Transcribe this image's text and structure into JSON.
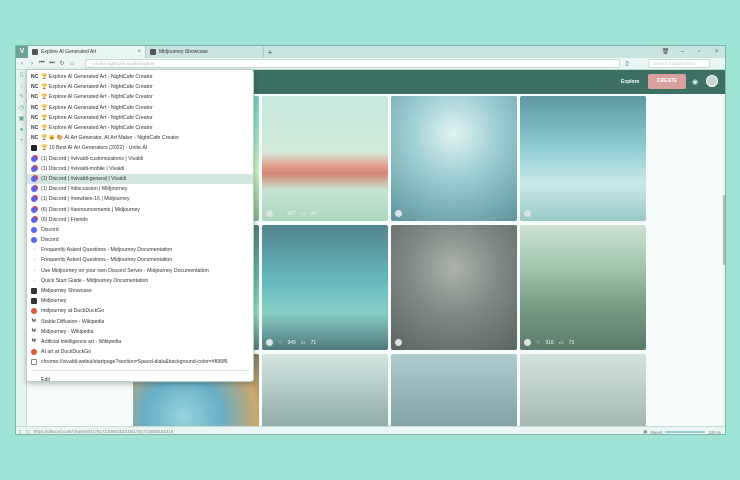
{
  "browser": {
    "tabs": [
      {
        "label": "Explore AI Generated Art",
        "active": true
      },
      {
        "label": "Midjourney Showcase",
        "active": false
      }
    ],
    "url": "creator.nightcafe.studio/explore",
    "search_placeholder": "Search DuckDuckGo",
    "status_url": "https://discord.com/channels/1751713080152316/1751713080152316",
    "zoom": "100 %",
    "reset_label": "Reset"
  },
  "site": {
    "explore_label": "Explore",
    "create_label": "CREATE",
    "accent": "#d9a0a0",
    "header_color": "#3e6f63"
  },
  "cards": [
    {
      "likes": "970",
      "comments": "43"
    },
    {
      "likes": "967",
      "comments": "24"
    },
    {
      "likes": "949",
      "comments": "71"
    },
    {
      "likes": "916",
      "comments": "73"
    }
  ],
  "menu": {
    "items": [
      {
        "icon": "nightcafe-icon",
        "label": "🏆 Explore AI Generated Art - NightCafe Creator"
      },
      {
        "icon": "nightcafe-icon",
        "label": "🏆 Explore AI Generated Art - NightCafe Creator"
      },
      {
        "icon": "nightcafe-icon",
        "label": "🏆 Explore AI Generated Art - NightCafe Creator"
      },
      {
        "icon": "nightcafe-icon",
        "label": "🏆 Explore AI Generated Art - NightCafe Creator"
      },
      {
        "icon": "nightcafe-icon",
        "label": "🏆 Explore AI Generated Art - NightCafe Creator"
      },
      {
        "icon": "nightcafe-icon",
        "label": "🏆 Explore AI Generated Art - NightCafe Creator"
      },
      {
        "icon": "nightcafe-icon",
        "label": "🏆 😺 🎨 AI Art Generator, AI Art Maker - NightCafe Creator"
      },
      {
        "icon": "unite-icon",
        "label": "🏆 10 Best AI Art Generators (2022) - Unite.AI"
      },
      {
        "icon": "discord-icon",
        "label": "(1) Discord | #vivaldi-customizations | Vivaldi"
      },
      {
        "icon": "discord-icon",
        "label": "(1) Discord | #vivaldi-mobile | Vivaldi"
      },
      {
        "icon": "discord-icon",
        "label": "(1) Discord | #vivaldi-general | Vivaldi",
        "selected": true
      },
      {
        "icon": "discord-icon",
        "label": "(1) Discord | #discussion | Midjourney"
      },
      {
        "icon": "discord-icon",
        "label": "(1) Discord | #newbies-16 | Midjourney"
      },
      {
        "icon": "discord-icon",
        "label": "(6) Discord | #announcements | Midjourney"
      },
      {
        "icon": "discord-icon",
        "label": "(6) Discord | Friends"
      },
      {
        "icon": "discord-icon",
        "label": "Discord"
      },
      {
        "icon": "discord-icon",
        "label": "Discord"
      },
      {
        "icon": "rss-icon",
        "label": "Frequently Asked Questions - Midjourney Documentation"
      },
      {
        "icon": "rss-icon",
        "label": "Frequently Asked Questions - Midjourney Documentation"
      },
      {
        "icon": "rss-icon",
        "label": "Use Midjourney on your own Discord Server - Midjourney Documentation"
      },
      {
        "icon": "rss-icon",
        "label": "Quick Start Guide - Midjourney Documentation"
      },
      {
        "icon": "midjourney-icon",
        "label": "Midjourney Showcase"
      },
      {
        "icon": "midjourney-icon",
        "label": "Midjourney"
      },
      {
        "icon": "duckduckgo-icon",
        "label": "midjourney at DuckDuckGo"
      },
      {
        "icon": "wikipedia-icon",
        "label": "Stable Diffusion - Wikipedia"
      },
      {
        "icon": "wikipedia-icon",
        "label": "Midjourney - Wikipedia"
      },
      {
        "icon": "wikipedia-icon",
        "label": "Artificial intelligence art - Wikipedia"
      },
      {
        "icon": "duckduckgo-icon",
        "label": "AI art at DuckDuckGo"
      },
      {
        "icon": "page-icon",
        "label": "chrome://vivaldi-webui/startpage?section=Speed-dials&background-color=#f6f6f6"
      }
    ],
    "edit_label": "Edit"
  }
}
